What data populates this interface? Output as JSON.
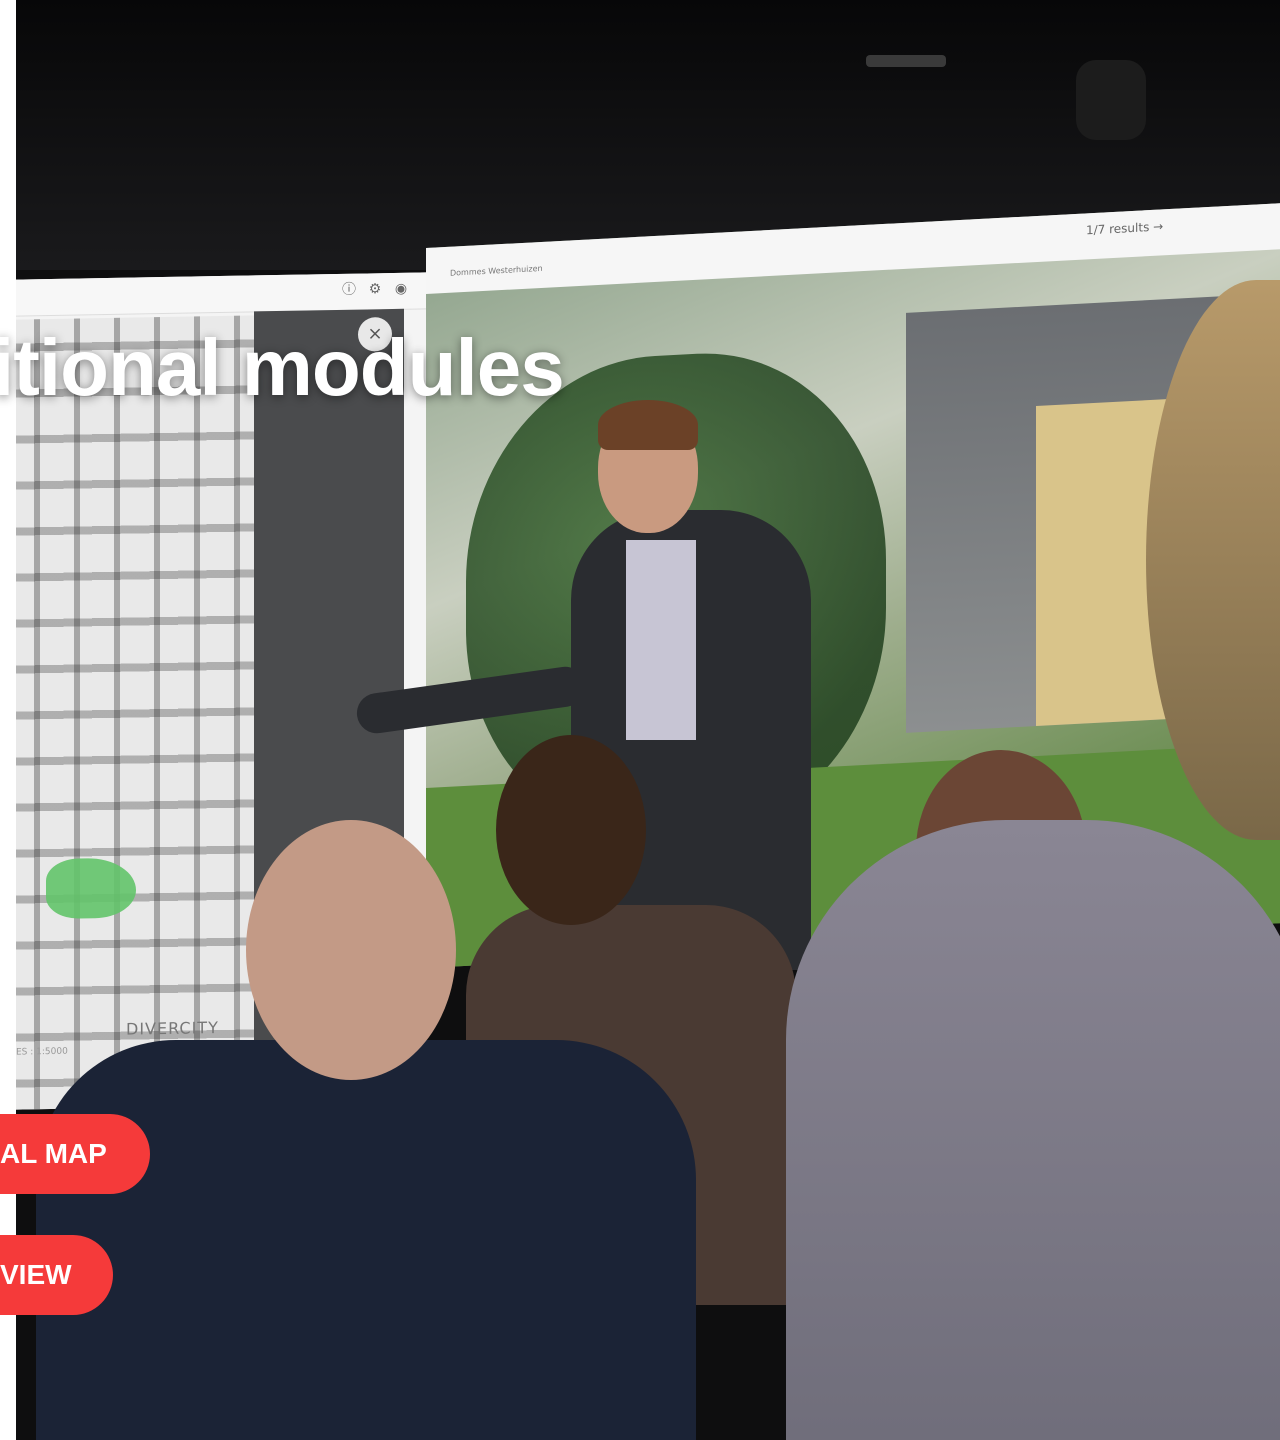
{
  "hero": {
    "heading": "itional modules"
  },
  "projection": {
    "left_screen": {
      "map_label": "DIVERCITY",
      "scale_label": "ES : 1:5000",
      "close_symbol": "×",
      "topbar_icons": [
        "info-icon",
        "gear-icon",
        "user-icon"
      ]
    },
    "right_screen": {
      "results_text": "1/7 results →",
      "home_label": "Dommes Westerhuizen"
    }
  },
  "buttons": {
    "map_label": "AL MAP",
    "view_label": "VIEW"
  },
  "colors": {
    "button_accent": "#f53a3a",
    "heading_text": "#ffffff"
  }
}
